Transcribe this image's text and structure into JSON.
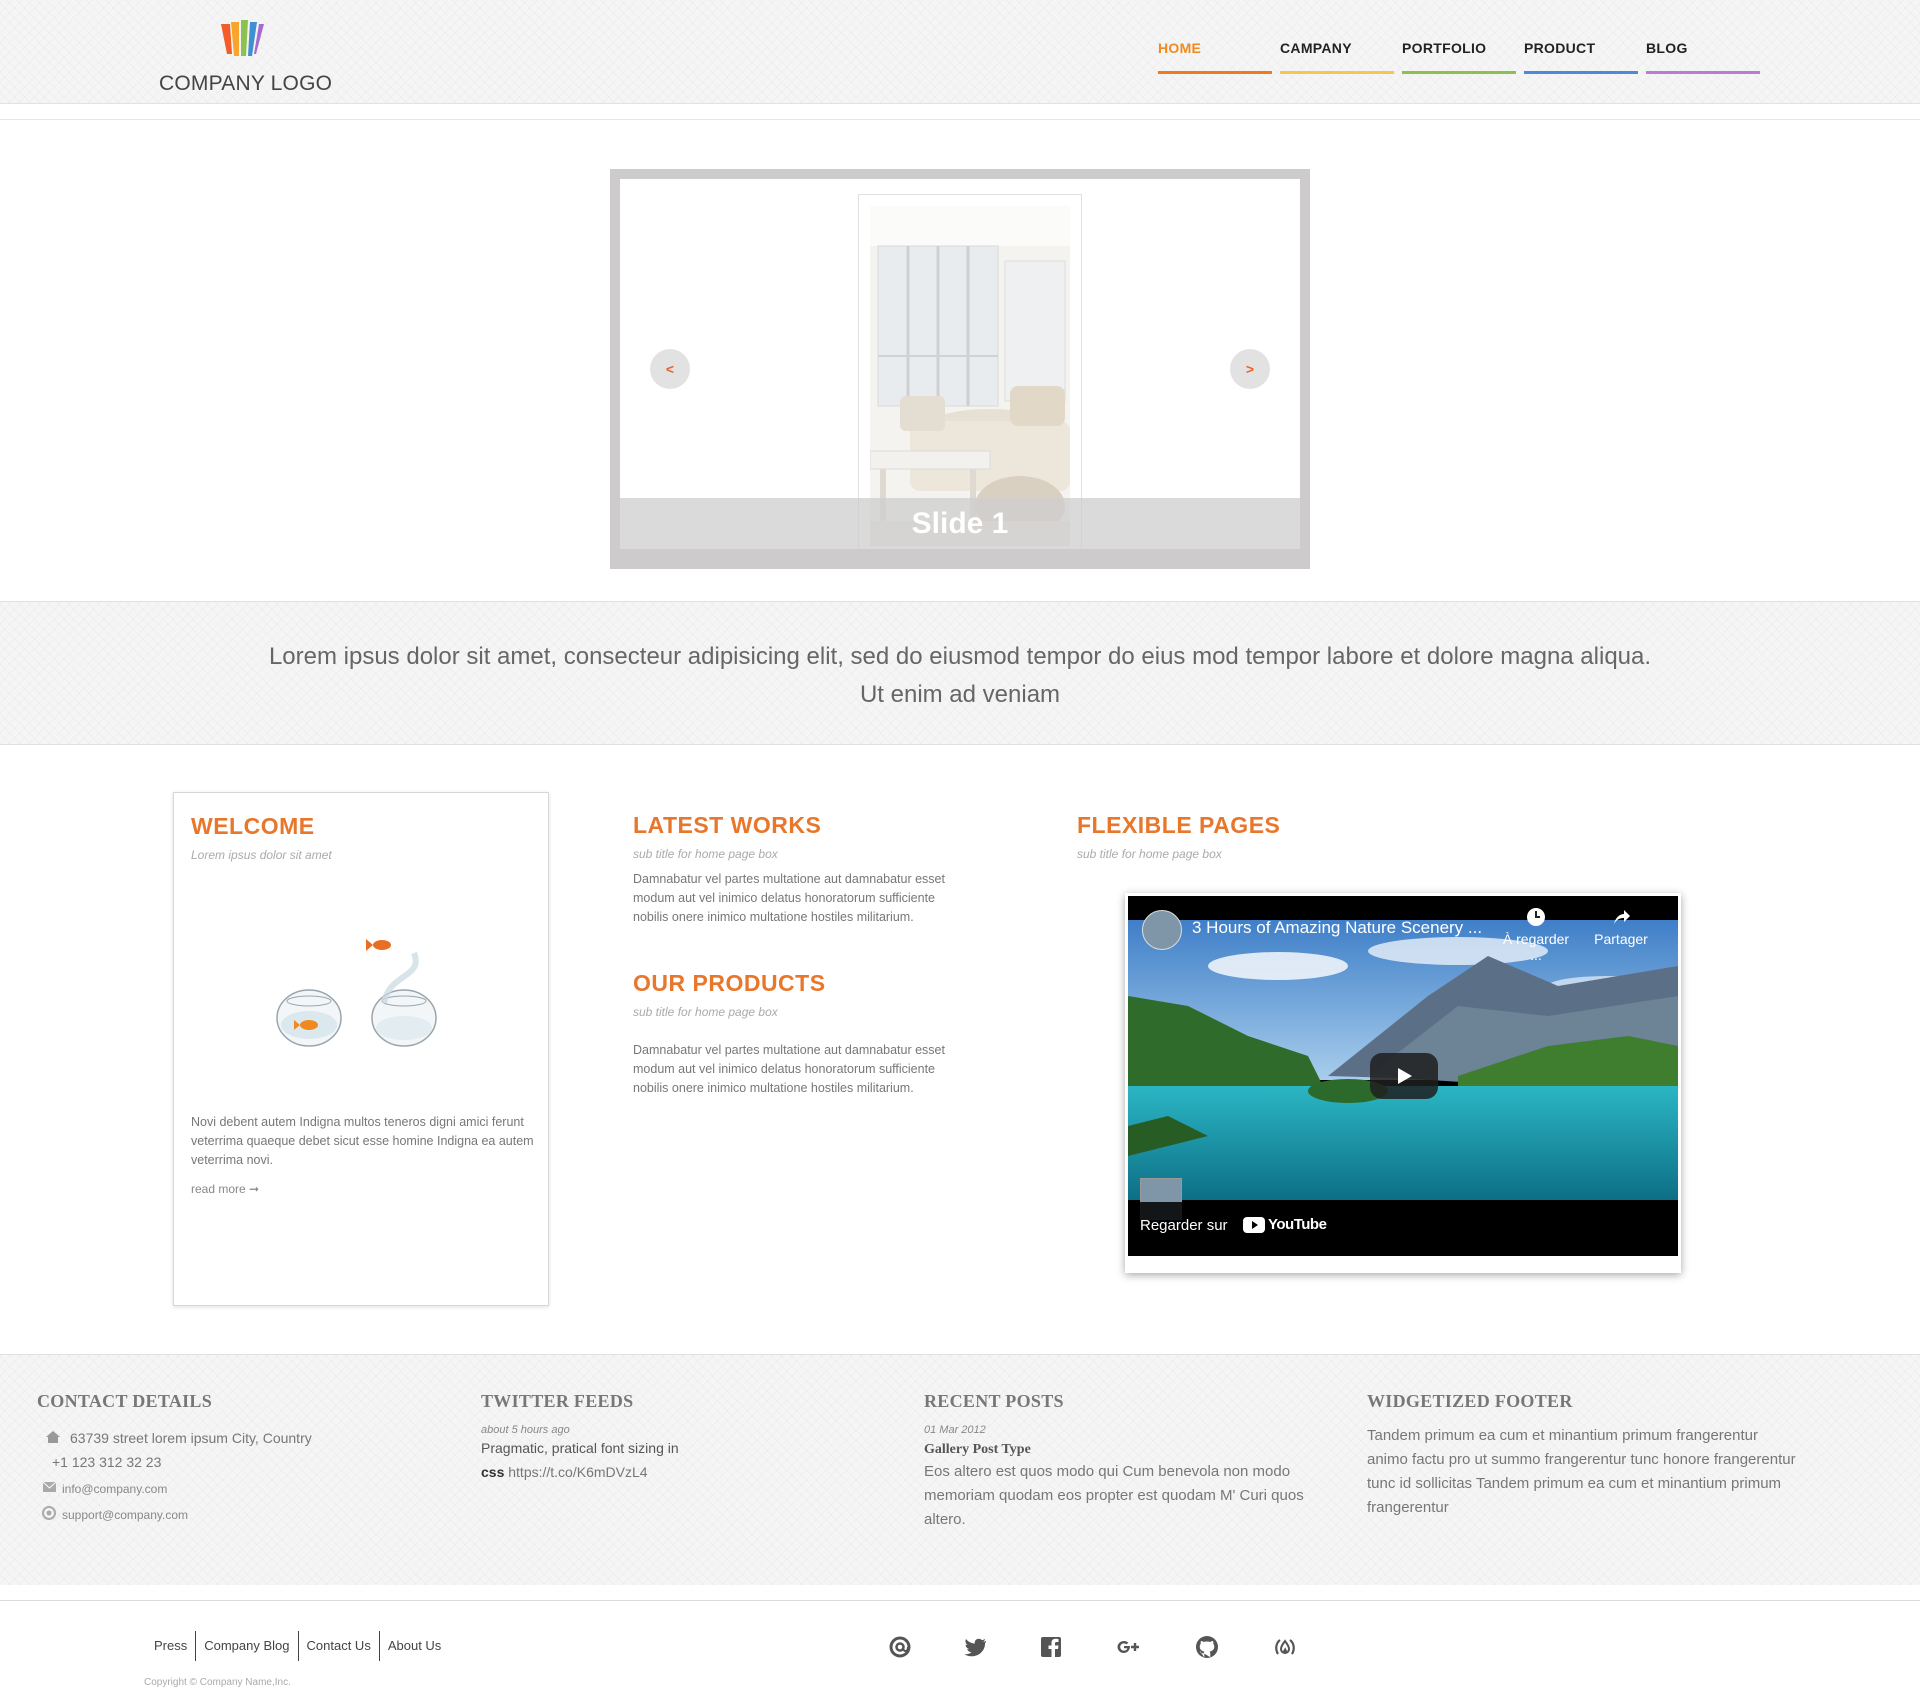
{
  "header": {
    "logo_text": "COMPANY LOGO",
    "nav": [
      {
        "label": "HOME",
        "color": "#f07a20"
      },
      {
        "label": "CAMPANY",
        "color": "#f5c84a"
      },
      {
        "label": "PORTFOLIO",
        "color": "#8cc152"
      },
      {
        "label": "PRODUCT",
        "color": "#4a89dc"
      },
      {
        "label": "BLOG",
        "color": "#b87bd6"
      }
    ]
  },
  "slider": {
    "caption": "Slide 1",
    "prev_label": "<",
    "next_label": ">"
  },
  "intro": {
    "line1": "Lorem ipsus dolor sit amet, consecteur adipisicing elit, sed do eiusmod tempor do eius mod tempor labore et dolore magna aliqua.",
    "line2": "Ut enim ad veniam"
  },
  "welcome": {
    "title": "WELCOME",
    "subtitle": "Lorem ipsus dolor sit amet",
    "body": "Novi debent autem Indigna multos teneros digni amici ferunt veterrima quaeque debet sicut esse homine Indigna ea autem veterrima novi.",
    "read_more": "read more ➞"
  },
  "latest_works": {
    "title": "LATEST WORKS",
    "subtitle": "sub title for home page box",
    "body": "Damnabatur vel partes multatione aut damnabatur esset modum aut vel inimico delatus honoratorum sufficiente nobilis onere inimico multatione hostiles militarium."
  },
  "our_products": {
    "title": "OUR PRODUCTS",
    "subtitle": "sub title for home page box",
    "body": "Damnabatur vel partes multatione aut damnabatur esset modum aut vel inimico delatus honoratorum sufficiente nobilis onere inimico multatione hostiles militarium."
  },
  "flexible_pages": {
    "title": "FLEXIBLE PAGES",
    "subtitle": "sub title for home page box",
    "video": {
      "title": "3 Hours of Amazing Nature Scenery ...",
      "watch_later": "À regarder ...",
      "share": "Partager",
      "watch_on": "Regarder sur",
      "platform": "YouTube"
    }
  },
  "footer": {
    "contact": {
      "heading": "CONTACT DETAILS",
      "address": "63739 street lorem ipsum City, Country",
      "phone": "+1 123 312 32 23",
      "email": "info@company.com",
      "support": "support@company.com"
    },
    "twitter": {
      "heading": "TWITTER FEEDS",
      "time": "about 5 hours ago",
      "text": "Pragmatic, pratical font sizing in",
      "bold": "css",
      "link": "https://t.co/K6mDVzL4"
    },
    "recent": {
      "heading": "RECENT POSTS",
      "date": "01 Mar 2012",
      "post_title": "Gallery Post Type",
      "post_body": "Eos altero est quos modo qui Cum benevola non modo memoriam quodam eos propter est quodam M' Curi quos altero."
    },
    "widget": {
      "heading": "WIDGETIZED FOOTER",
      "body": "Tandem primum ea cum et minantium primum frangerentur animo factu pro ut summo frangerentur tunc honore frangerentur tunc id sollicitas Tandem primum ea cum et minantium primum frangerentur"
    },
    "links": [
      "Press",
      "Company Blog",
      "Contact Us",
      "About Us"
    ],
    "social": [
      "at-icon",
      "twitter-icon",
      "facebook-icon",
      "google-plus-icon",
      "github-icon",
      "feed-icon"
    ],
    "copyright": "Copyright © Company Name,Inc."
  }
}
